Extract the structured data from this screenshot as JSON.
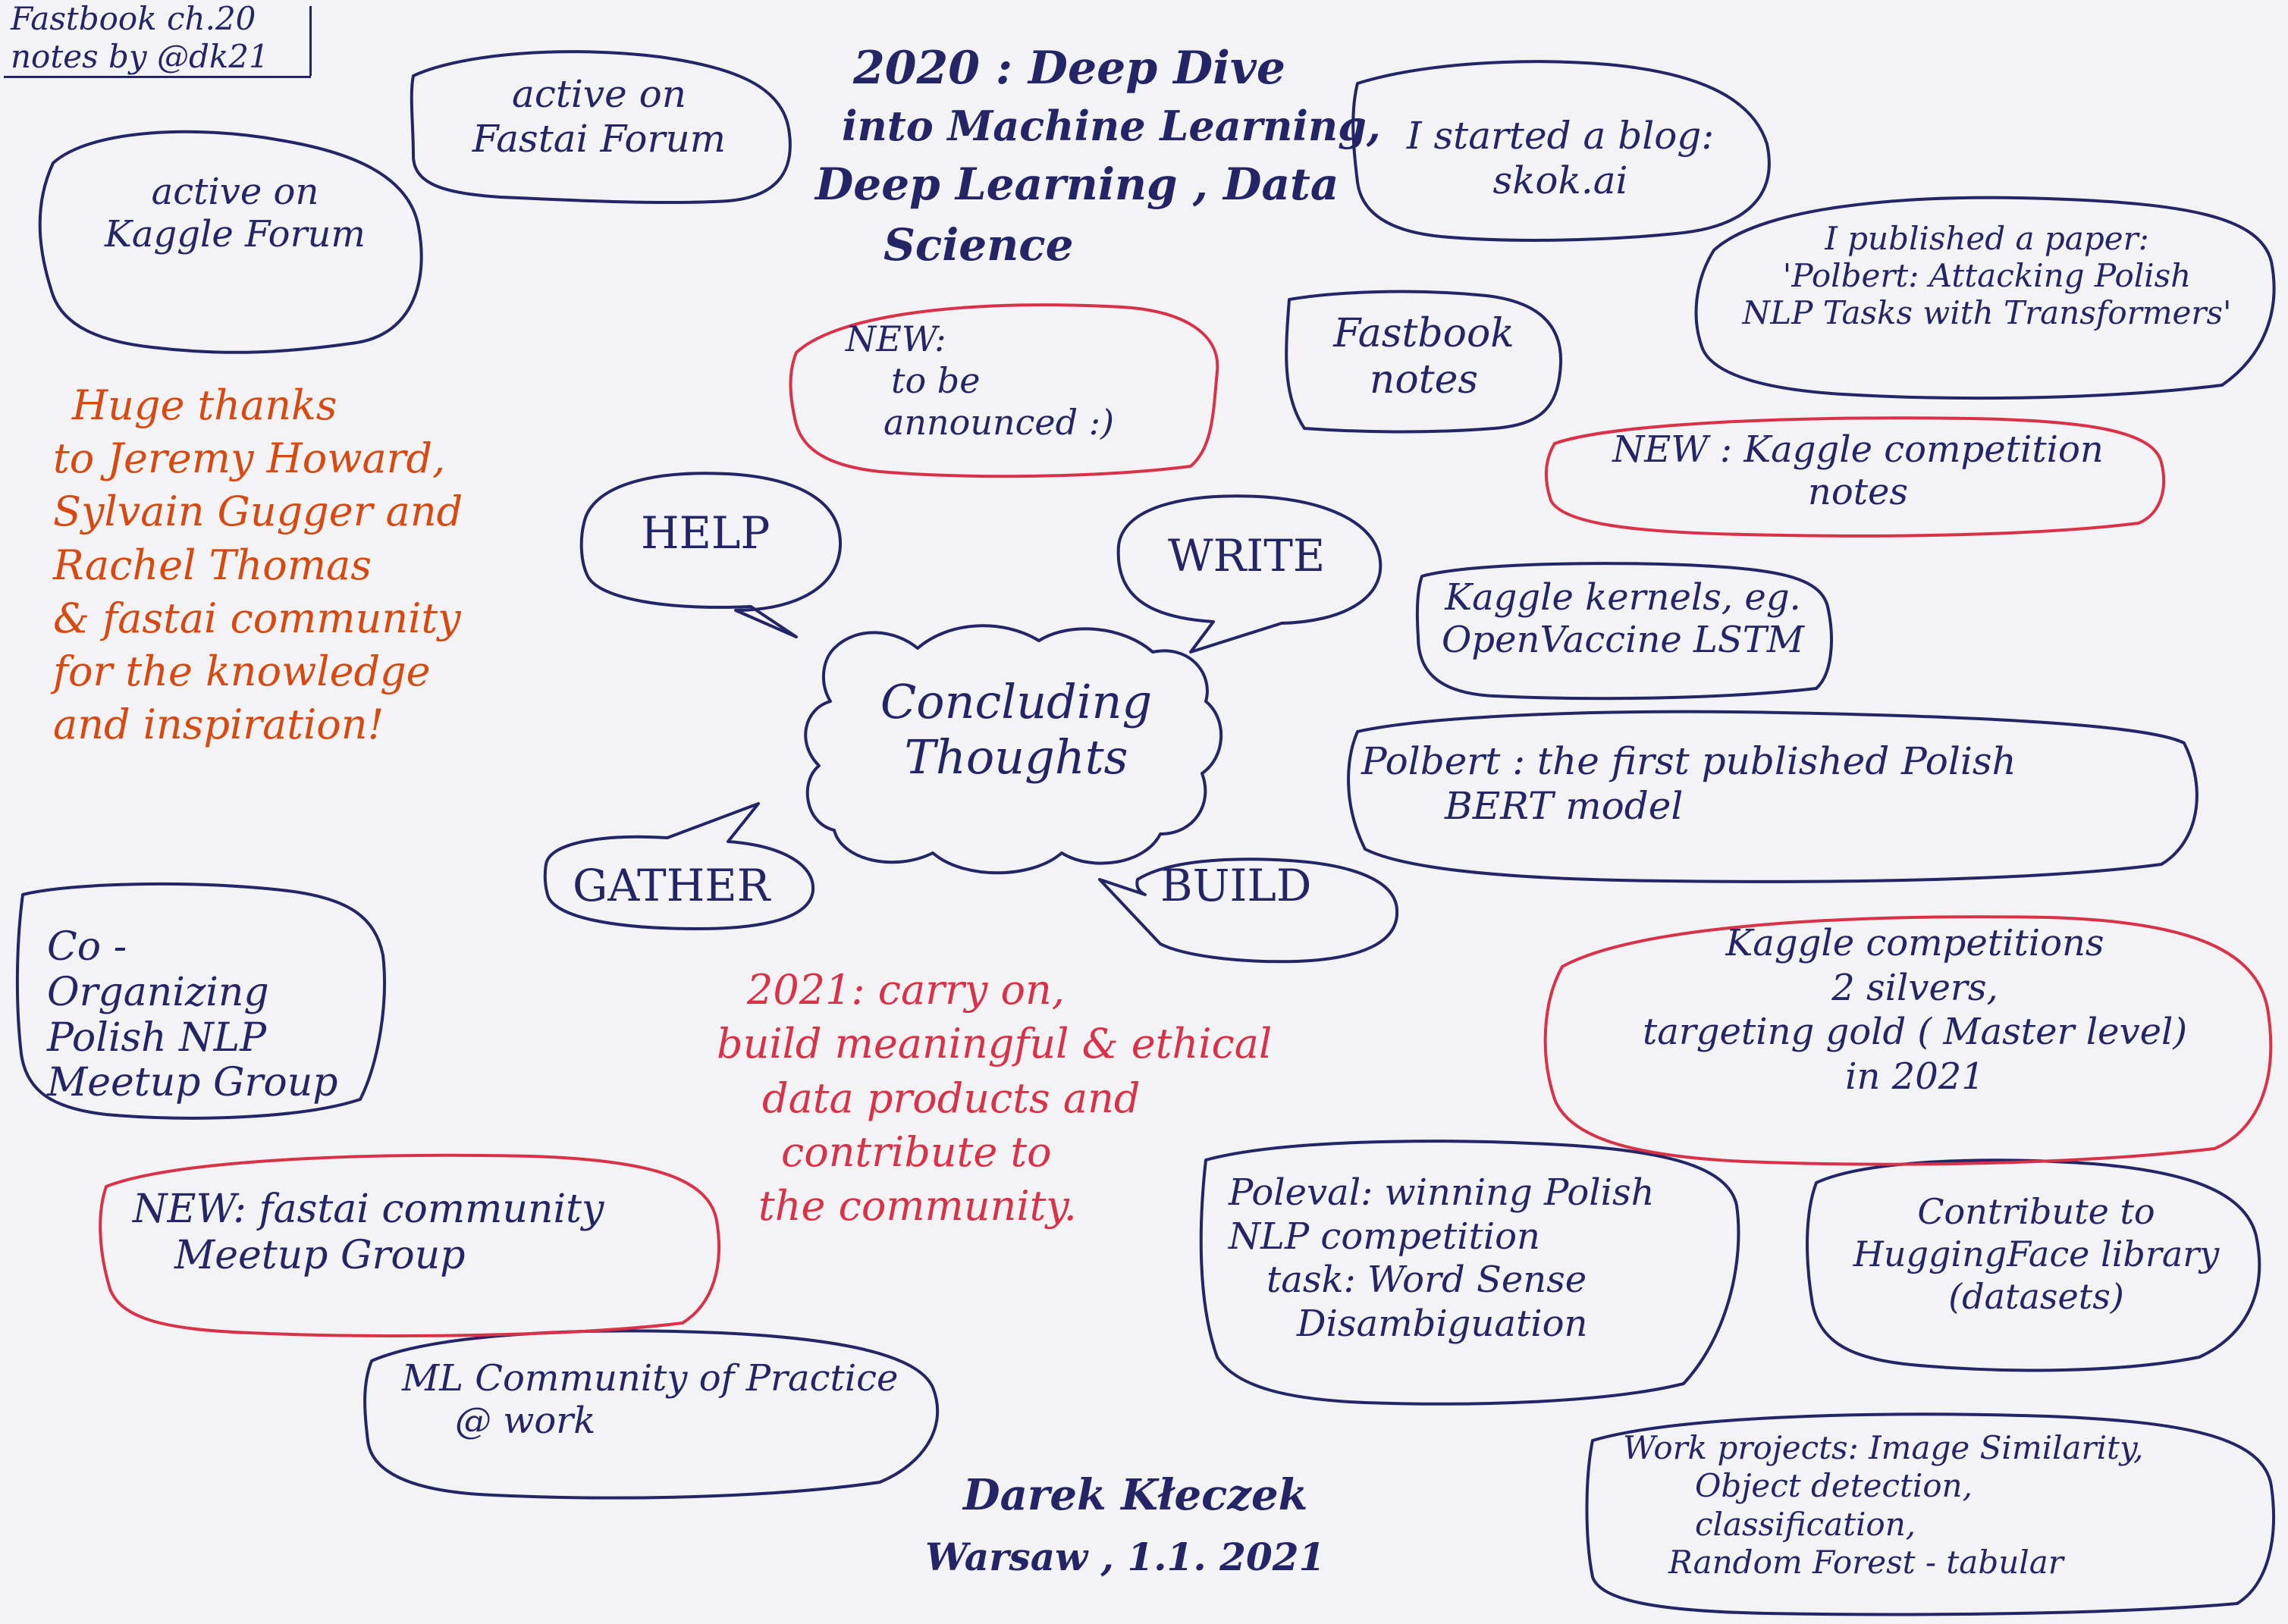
{
  "header": {
    "note_line1": "Fastbook ch.20",
    "note_line2": "notes by @dk21"
  },
  "title": [
    "2020 : Deep Dive",
    "into Machine Learning,",
    "Deep Learning , Data",
    "Science"
  ],
  "center": {
    "label": [
      "Concluding",
      "Thoughts"
    ],
    "help": "HELP",
    "write": "WRITE",
    "gather": "GATHER",
    "build": "BUILD"
  },
  "clouds": {
    "kaggle_forum": [
      "active on",
      "Kaggle Forum"
    ],
    "fastai_forum": [
      "active on",
      "Fastai Forum"
    ],
    "blog": [
      "I started a blog:",
      "skok.ai"
    ],
    "paper": [
      "I published a paper:",
      "'Polbert: Attacking Polish",
      "NLP Tasks with Transformers'"
    ],
    "new_announced": [
      "NEW:",
      "to be",
      "announced :)"
    ],
    "fastbook_notes": [
      "Fastbook",
      "notes"
    ],
    "kaggle_notes": [
      "NEW : Kaggle competition",
      "notes"
    ],
    "kaggle_kernels": [
      "Kaggle kernels, eg.",
      "OpenVaccine LSTM"
    ],
    "polbert": [
      "Polbert : the first published Polish",
      "BERT model"
    ],
    "kaggle_competitions": [
      "Kaggle competitions",
      "2 silvers,",
      "targeting gold ( Master level)",
      "in 2021"
    ],
    "co_organizing": [
      "Co -",
      "Organizing",
      "Polish NLP",
      "Meetup Group"
    ],
    "fastai_meetup": [
      "NEW: fastai community",
      "Meetup Group"
    ],
    "ml_community": [
      "ML Community of Practice",
      "@ work"
    ],
    "poleval": [
      "Poleval: winning Polish",
      "NLP competition",
      "task: Word Sense",
      "Disambiguation"
    ],
    "huggingface": [
      "Contribute to",
      "HuggingFace library",
      "(datasets)"
    ],
    "work_projects": [
      "Work projects: Image Similarity,",
      "Object detection,",
      "classification,",
      "Random Forest - tabular"
    ]
  },
  "thanks": [
    "Huge thanks",
    "to Jeremy Howard,",
    "Sylvain Gugger and",
    "Rachel Thomas",
    "& fastai community",
    "for the knowledge",
    "and inspiration!"
  ],
  "plan_2021": [
    "2021: carry on,",
    "build meaningful & ethical",
    "data products and",
    "contribute to",
    "the community."
  ],
  "signature": {
    "name": "Darek Kłeczek",
    "place_date": "Warsaw , 1.1. 2021"
  },
  "colors": {
    "ink_blue": "#232566",
    "ink_red": "#d83248",
    "ink_orange": "#d64a12",
    "paper": "#f3f2f4"
  }
}
